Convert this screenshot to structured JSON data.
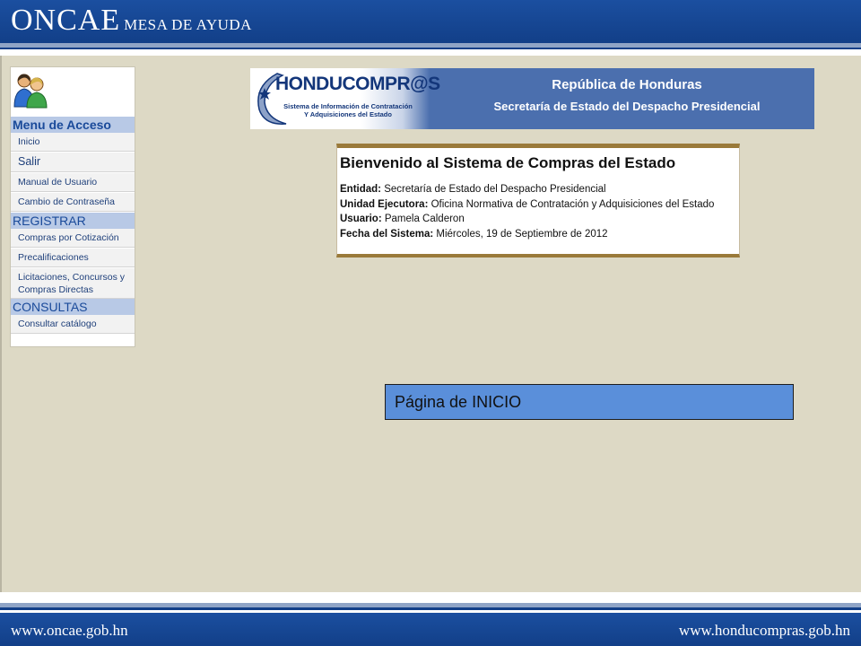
{
  "header": {
    "brand": "ONCAE",
    "subtitle": "MESA DE AYUDA"
  },
  "nav": {
    "menu_title": "Menu de Acceso",
    "items_acceso": [
      {
        "label": "Inicio"
      },
      {
        "label": "Salir"
      },
      {
        "label": "Manual de Usuario"
      },
      {
        "label": "Cambio de Contraseña"
      }
    ],
    "registrar_title": "REGISTRAR",
    "items_registrar": [
      {
        "label": "Compras por Cotización"
      },
      {
        "label": "Precalificaciones"
      },
      {
        "label": "Licitaciones, Concursos y Compras Directas"
      }
    ],
    "consultas_title": "CONSULTAS",
    "items_consultas": [
      {
        "label": "Consultar catálogo"
      }
    ]
  },
  "banner": {
    "logo_title": "HONDUCOMPR@S",
    "logo_subtitle": "Sistema de Información de Contratación Y Adquisiciones del Estado",
    "title": "República de Honduras",
    "subtitle": "Secretaría de Estado del Despacho Presidencial"
  },
  "welcome": {
    "title": "Bienvenido al Sistema de Compras del Estado",
    "entidad_label": "Entidad:",
    "entidad_value": "Secretaría de Estado del Despacho Presidencial",
    "unidad_label": "Unidad Ejecutora:",
    "unidad_value": "Oficina Normativa de Contratación y Adquisiciones del Estado",
    "usuario_label": "Usuario:",
    "usuario_value": "Pamela Calderon",
    "fecha_label": "Fecha del Sistema:",
    "fecha_value": "Miércoles, 19 de Septiembre de 2012"
  },
  "callout": {
    "text": "Página de INICIO"
  },
  "footer": {
    "left": "www.oncae.gob.hn",
    "right": "www.honducompras.gob.hn"
  },
  "colors": {
    "header_blue": "#1b4fa0",
    "content_bg": "#ddd9c5",
    "nav_section": "#b8c9e6",
    "callout_bg": "#5a8fda",
    "welcome_border": "#9a7a3a"
  },
  "icons": {
    "avatar": "users-icon"
  }
}
